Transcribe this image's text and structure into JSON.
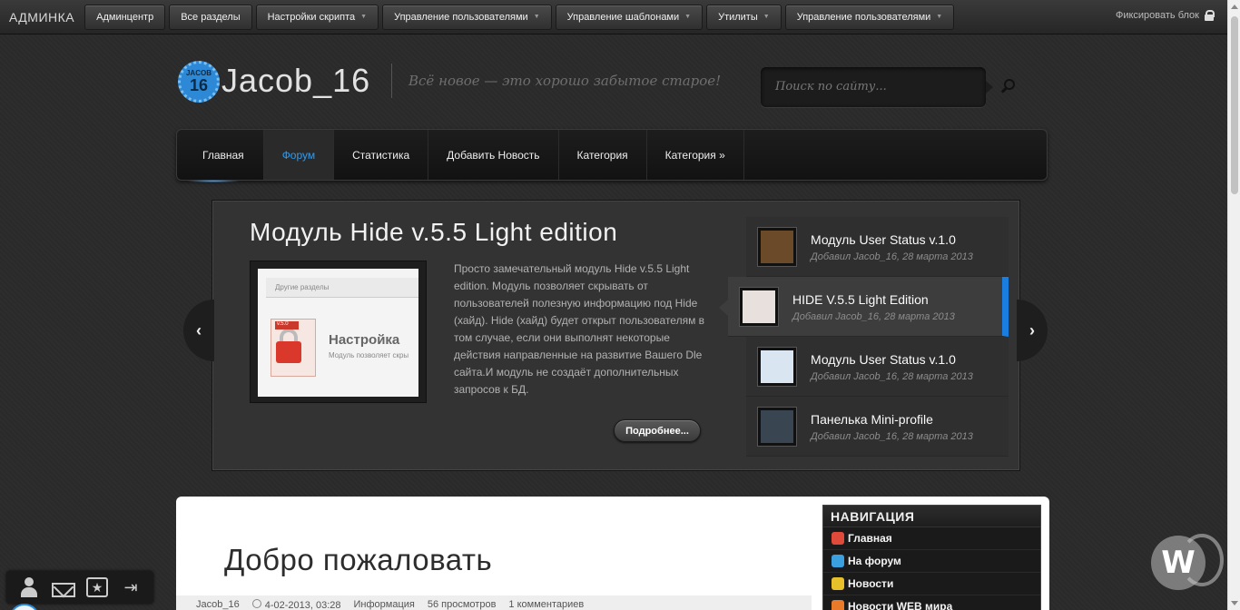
{
  "adminbar": {
    "brand": "АДМИНКА",
    "buttons": [
      {
        "label": "Админцентр",
        "dropdown": false
      },
      {
        "label": "Все разделы",
        "dropdown": false
      },
      {
        "label": "Настройки скрипта",
        "dropdown": true
      },
      {
        "label": "Управление пользователями",
        "dropdown": true
      },
      {
        "label": "Управление шаблонами",
        "dropdown": true
      },
      {
        "label": "Утилиты",
        "dropdown": true
      },
      {
        "label": "Управление пользователями",
        "dropdown": true
      }
    ],
    "fix_block": "Фиксировать блок"
  },
  "header": {
    "badge_top": "JACOB",
    "badge_num": "16",
    "site_name": "Jacob_16",
    "slogan": "Всё новое — это хорошо забытое старое!",
    "search_placeholder": "Поиск по сайту..."
  },
  "nav": {
    "items": [
      "Главная",
      "Форум",
      "Статистика",
      "Добавить Новость",
      "Категория",
      "Категория »"
    ],
    "active_index": 1
  },
  "slider": {
    "title": "Модуль Hide v.5.5 Light edition",
    "image": {
      "top_bar": "Другие разделы",
      "version": "v.5.0",
      "heading": "Настройка",
      "subtext": "Модуль позволяет скры"
    },
    "description": "Просто замечательный модуль Hide v.5.5 Light edition. Модуль позволяет скрывать от пользователей полезную информацию под Hide (хайд). Hide (хайд) будет открыт пользователям в том случае, если они выполнят некоторые действия направленные на развитие Вашего Dle сайта.И модуль не создаёт дополнительных запросов к БД.",
    "more_label": "Подробнее...",
    "prev_label": "‹",
    "next_label": "›",
    "thumbs": [
      {
        "title": "Модуль User Status v.1.0",
        "meta": "Добавил Jacob_16, 28 марта 2013",
        "active": false,
        "color": "#6b4a2a"
      },
      {
        "title": "HIDE V.5.5 Light Edition",
        "meta": "Добавил Jacob_16, 28 марта 2013",
        "active": true,
        "color": "#e8e0dc"
      },
      {
        "title": "Модуль User Status v.1.0",
        "meta": "Добавил Jacob_16, 28 марта 2013",
        "active": false,
        "color": "#d9e6f2"
      },
      {
        "title": "Панелька Mini-profile",
        "meta": "Добавил Jacob_16, 28 марта 2013",
        "active": false,
        "color": "#3a4552"
      }
    ]
  },
  "content": {
    "welcome": "Добро пожаловать",
    "meta": {
      "author": "Jacob_16",
      "date": "4-02-2013, 03:28",
      "category": "Информация",
      "views": "56 просмотров",
      "comments": "1 комментариев"
    }
  },
  "sidebar": {
    "heading": "НАВИГАЦИЯ",
    "items": [
      {
        "label": "Главная",
        "icon_color": "#e04a3a"
      },
      {
        "label": "На форум",
        "icon_color": "#3aa0e0"
      },
      {
        "label": "Новости",
        "icon_color": "#e8c02a"
      },
      {
        "label": "Новости WEB мира",
        "icon_color": "#e87a2a"
      }
    ]
  },
  "watermark_letter": "W"
}
